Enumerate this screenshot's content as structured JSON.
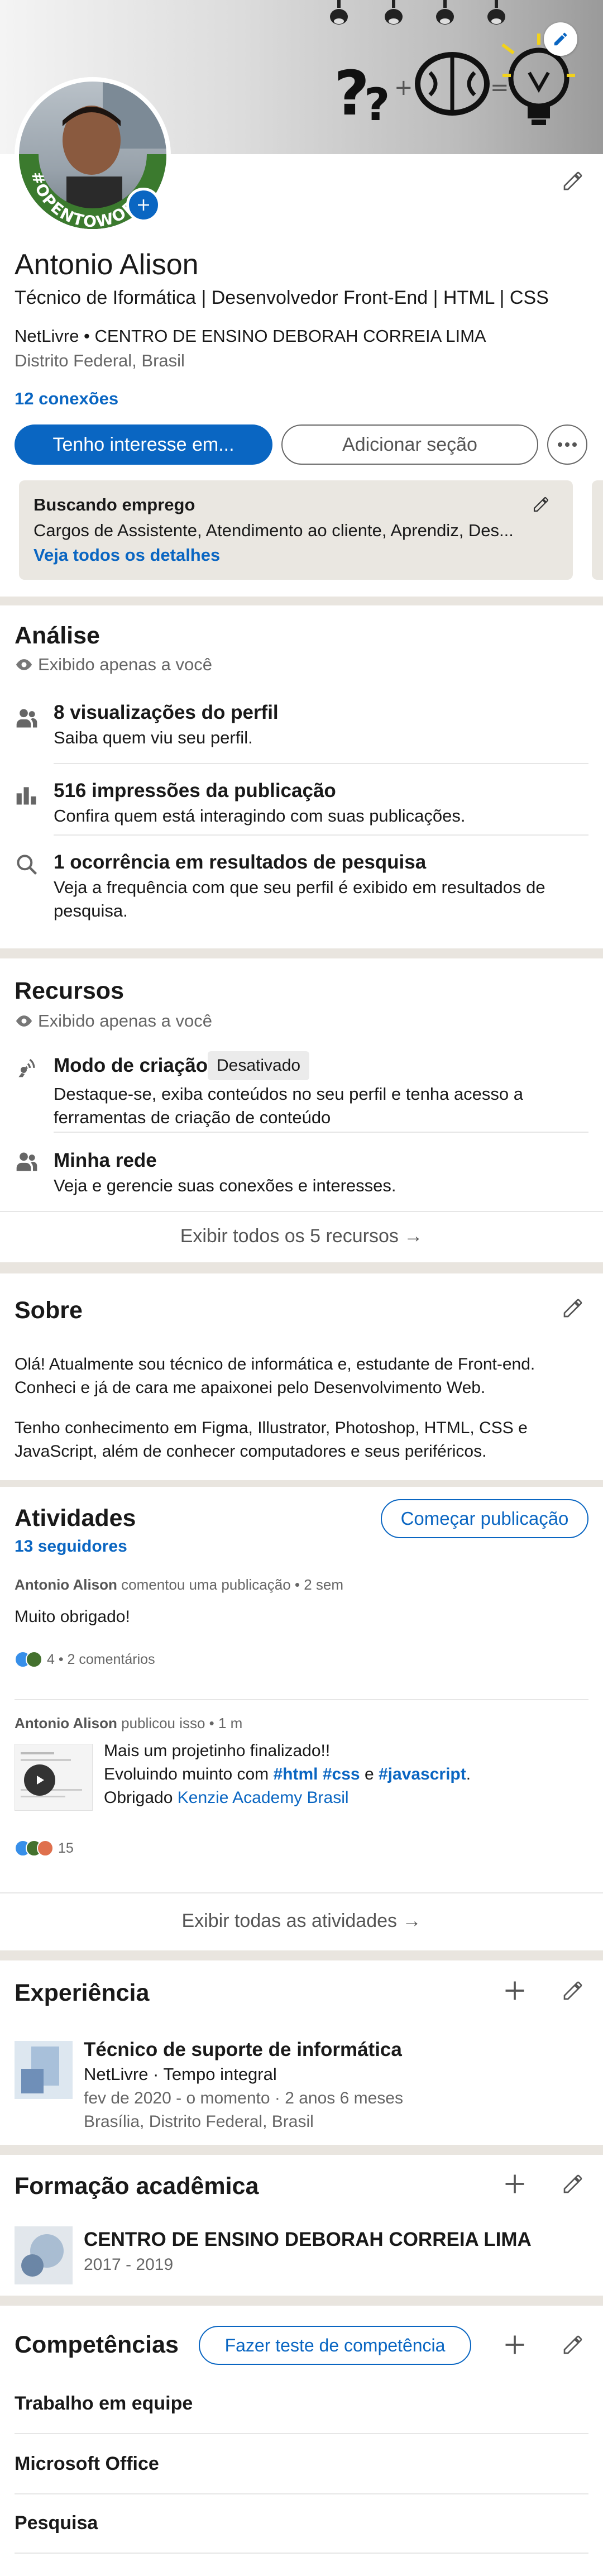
{
  "profile": {
    "name": "Antonio Alison",
    "headline": "Técnico de Iformática | Desenvolvedor Front-End | HTML | CSS",
    "company_line": "NetLivre • CENTRO DE ENSINO DEBORAH CORREIA LIMA",
    "location": "Distrito Federal, Brasil",
    "connections": "12 conexões",
    "open_to_work_badge": "#OPENTOWORK",
    "primary_button": "Tenho interesse em...",
    "secondary_button": "Adicionar seção",
    "more_icon": "more-icon"
  },
  "job_seeking": {
    "title": "Buscando emprego",
    "roles": "Cargos de Assistente, Atendimento ao cliente, Aprendiz, Des...",
    "link": "Veja todos os detalhes"
  },
  "analytics": {
    "title": "Análise",
    "visibility": "Exibido apenas a você",
    "items": [
      {
        "title": "8 visualizações do perfil",
        "desc": "Saiba quem viu seu perfil.",
        "icon": "people-icon"
      },
      {
        "title": "516 impressões da publicação",
        "desc": "Confira quem está interagindo com suas publicações.",
        "icon": "bar-chart-icon"
      },
      {
        "title": "1 ocorrência em resultados de pesquisa",
        "desc": "Veja a frequência com que seu perfil é exibido em resultados de pesquisa.",
        "icon": "search-icon"
      }
    ]
  },
  "resources": {
    "title": "Recursos",
    "visibility": "Exibido apenas a você",
    "creator_title": "Modo de criação",
    "creator_badge": "Desativado",
    "creator_desc": "Destaque-se, exiba conteúdos no seu perfil e tenha acesso a ferramentas de criação de conteúdo",
    "network_title": "Minha rede",
    "network_desc": "Veja e gerencie suas conexões e interesses.",
    "show_all": "Exibir todos os 5 recursos →"
  },
  "about": {
    "title": "Sobre",
    "p1": "Olá! Atualmente sou técnico de informática e, estudante de Front-end. Conheci e já de cara me apaixonei pelo Desenvolvimento Web.",
    "p2": "Tenho conhecimento em Figma, Illustrator, Photoshop, HTML, CSS e JavaScript, além de conhecer computadores e seus periféricos."
  },
  "activity": {
    "title": "Atividades",
    "followers": "13 seguidores",
    "start_post": "Começar publicação",
    "post1": {
      "author": "Antonio Alison",
      "meta": "comentou uma publicação • 2 sem",
      "text": "Muito obrigado!",
      "stats": "4 • 2 comentários"
    },
    "post2": {
      "author": "Antonio Alison",
      "meta": "publicou isso • 1 m",
      "line1": "Mais um projetinho finalizado!!",
      "line2_start": "Evoluindo muinto com ",
      "tag1": "#html",
      "tag2": "#css",
      "line2_mid": " e ",
      "tag3": "#javascript",
      "line2_end": ".",
      "line3_start": "Obrigado ",
      "mention": "Kenzie Academy Brasil",
      "stats": "15"
    },
    "show_all": "Exibir todas as atividades →"
  },
  "experience": {
    "title": "Experiência",
    "job_title": "Técnico de suporte de informática",
    "company": "NetLivre · Tempo integral",
    "dates": "fev de 2020 - o momento · 2 anos 6 meses",
    "location": "Brasília, Distrito Federal, Brasil"
  },
  "education": {
    "title": "Formação acadêmica",
    "school": "CENTRO DE ENSINO DEBORAH CORREIA LIMA",
    "years": "2017 - 2019"
  },
  "skills": {
    "title": "Competências",
    "test_button": "Fazer teste de competência",
    "items": [
      "Trabalho em equipe",
      "Microsoft Office",
      "Pesquisa"
    ]
  }
}
